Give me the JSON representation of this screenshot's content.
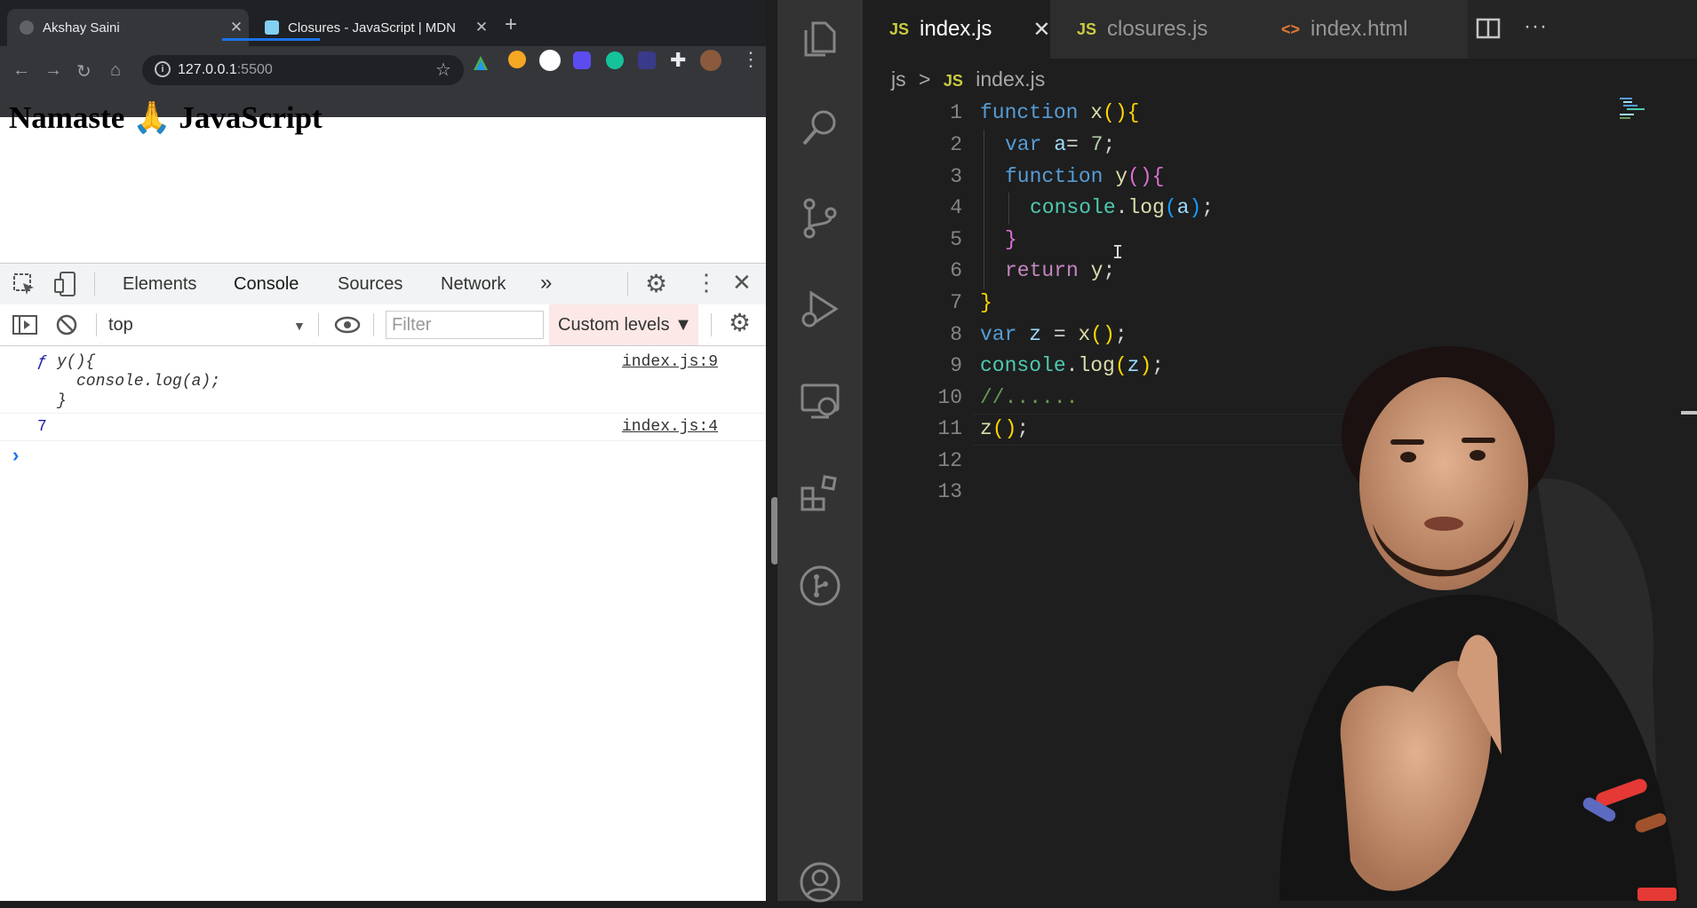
{
  "browser": {
    "tabs": [
      {
        "title": "Akshay Saini",
        "active": true
      },
      {
        "title": "Closures - JavaScript | MDN",
        "active": false
      }
    ],
    "url_host": "127.0.0.1",
    "url_port": ":5500",
    "page_heading": "Namaste 🙏 JavaScript"
  },
  "devtools": {
    "tabs": [
      "Elements",
      "Console",
      "Sources",
      "Network"
    ],
    "more_tabs": "»",
    "context": "top",
    "filter_placeholder": "Filter",
    "levels_label": "Custom levels ▼",
    "messages": [
      {
        "f_mark": "ƒ",
        "lines": [
          "y(){",
          "console.log(a);",
          "}"
        ],
        "source": "index.js:9"
      },
      {
        "value": "7",
        "source": "index.js:4"
      }
    ],
    "prompt": "›"
  },
  "vscode": {
    "tabs": [
      {
        "icon": "JS",
        "label": "index.js",
        "active": true,
        "close": "✕"
      },
      {
        "icon": "JS",
        "label": "closures.js",
        "active": false
      },
      {
        "icon": "<>",
        "label": "index.html",
        "active": false
      }
    ],
    "breadcrumb": {
      "folder": "js",
      "sep": ">",
      "icon": "JS",
      "file": "index.js"
    },
    "line_numbers": [
      "1",
      "2",
      "3",
      "4",
      "5",
      "6",
      "7",
      "8",
      "9",
      "10",
      "11",
      "12",
      "13"
    ],
    "code": {
      "l1": [
        "function",
        "x",
        "()",
        "{"
      ],
      "l2": [
        "var",
        "a",
        "= ",
        "7",
        ";"
      ],
      "l3": [
        "function",
        "y",
        "()",
        "{"
      ],
      "l4": [
        "console",
        ".",
        "log",
        "(",
        "a",
        ")",
        ";"
      ],
      "l5": [
        "}"
      ],
      "l6": [
        "return",
        "y",
        ";"
      ],
      "l7": [
        "}"
      ],
      "l8": [
        "var",
        "z",
        " = ",
        "x",
        "()",
        ";"
      ],
      "l9": [
        "console",
        ".",
        "log",
        "(",
        "z",
        ")",
        ";"
      ],
      "l10": [
        "//......"
      ],
      "l11": [
        "z",
        "()",
        ";"
      ]
    },
    "layout_icon": "split-editor-icon",
    "more_icon": "···"
  },
  "colors": {
    "accent": "#1a73e8",
    "keyword": "#569cd6",
    "function": "#dcdcaa"
  }
}
